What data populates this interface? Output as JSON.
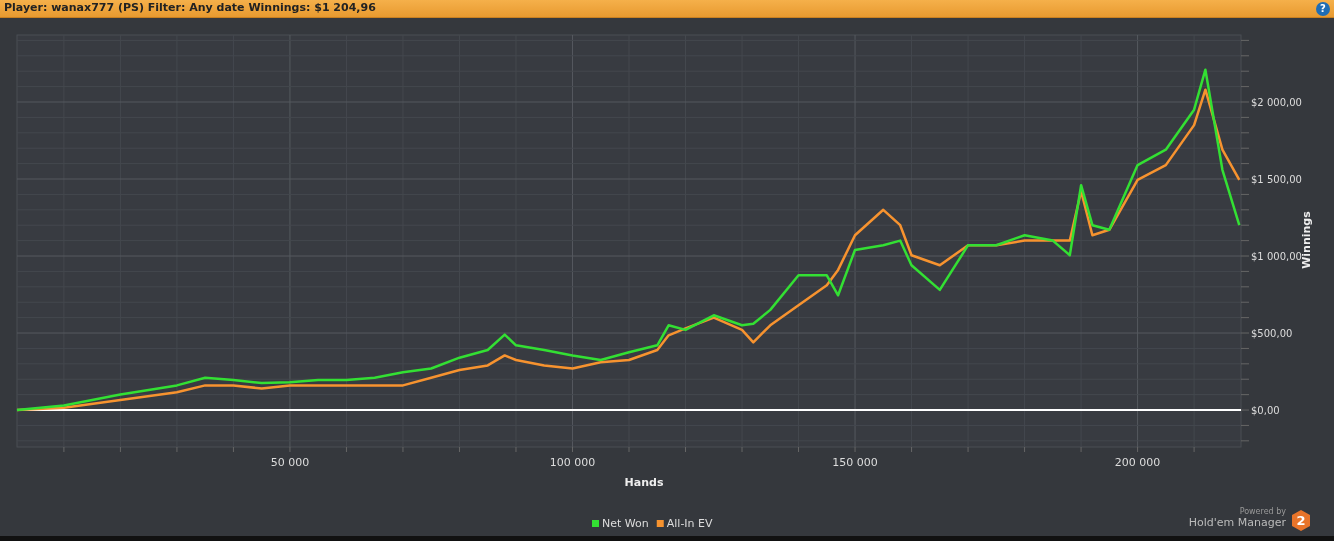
{
  "header": {
    "text": "Player: wanax777 (PS) Filter: Any date Winnings: $1 204,96",
    "help": "?"
  },
  "chart": {
    "chart_data": {
      "type": "line",
      "xlabel": "Hands",
      "ylabel": "Winnings",
      "x": [
        1700,
        10000,
        20000,
        30000,
        35000,
        40000,
        45000,
        50000,
        55000,
        60000,
        65000,
        70000,
        75000,
        80000,
        85000,
        88000,
        90000,
        95000,
        100000,
        105000,
        110000,
        115000,
        117000,
        120000,
        125000,
        130000,
        132000,
        135000,
        140000,
        145000,
        147000,
        150000,
        155000,
        158000,
        160000,
        165000,
        170000,
        175000,
        180000,
        185000,
        188000,
        190000,
        192000,
        195000,
        200000,
        205000,
        210000,
        212000,
        215000,
        218000
      ],
      "series": [
        {
          "name": "Net Won",
          "color": "#33e033",
          "values": [
            0,
            30,
            100,
            160,
            210,
            195,
            175,
            180,
            195,
            195,
            210,
            245,
            270,
            340,
            390,
            490,
            420,
            390,
            355,
            325,
            375,
            420,
            550,
            520,
            615,
            550,
            560,
            650,
            875,
            875,
            745,
            1040,
            1070,
            1100,
            940,
            780,
            1070,
            1070,
            1135,
            1100,
            1005,
            1460,
            1200,
            1170,
            1590,
            1690,
            1950,
            2210,
            1560,
            1200
          ]
        },
        {
          "name": "All-In EV",
          "color": "#f7932f",
          "values": [
            0,
            15,
            65,
            115,
            160,
            160,
            140,
            160,
            160,
            160,
            160,
            160,
            210,
            260,
            290,
            355,
            325,
            290,
            270,
            310,
            325,
            390,
            485,
            530,
            600,
            520,
            440,
            550,
            680,
            810,
            910,
            1135,
            1300,
            1200,
            1005,
            940,
            1070,
            1070,
            1100,
            1100,
            1100,
            1420,
            1135,
            1170,
            1495,
            1590,
            1850,
            2080,
            1690,
            1495
          ]
        }
      ],
      "grid": {
        "x": true,
        "y": true
      },
      "legend": true,
      "xlim": [
        1700,
        218300
      ],
      "ylim": [
        -240,
        2435
      ],
      "xticks": [
        {
          "value": 50000,
          "label": "50 000"
        },
        {
          "value": 100000,
          "label": "100 000"
        },
        {
          "value": 150000,
          "label": "150 000"
        },
        {
          "value": 200000,
          "label": "200 000"
        }
      ],
      "yticks": [
        {
          "value": 0,
          "label": "$0,00"
        },
        {
          "value": 500,
          "label": "$500,00"
        },
        {
          "value": 1000,
          "label": "$1 000,00"
        },
        {
          "value": 1500,
          "label": "$1 500,00"
        },
        {
          "value": 2000,
          "label": "$2 000,00"
        }
      ]
    }
  },
  "branding": {
    "powered_by": "Powered by",
    "product": "Hold'em Manager",
    "badge": "2"
  }
}
